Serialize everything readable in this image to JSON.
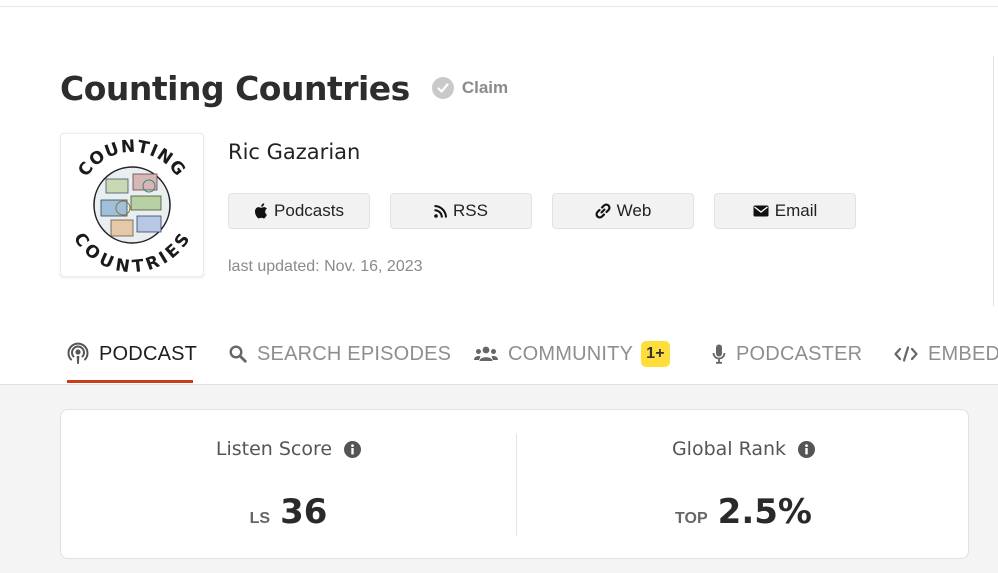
{
  "header": {
    "title": "Counting Countries",
    "claim_label": "Claim",
    "author": "Ric Gazarian",
    "last_updated": "last updated: Nov. 16, 2023"
  },
  "artwork": {
    "top_text": "COUNTING",
    "bottom_text": "COUNTRIES"
  },
  "links": [
    {
      "label": "Podcasts",
      "icon": "apple-icon"
    },
    {
      "label": "RSS",
      "icon": "rss-icon"
    },
    {
      "label": "Web",
      "icon": "link-icon"
    },
    {
      "label": "Email",
      "icon": "envelope-icon"
    }
  ],
  "tabs": [
    {
      "label": "PODCAST",
      "icon": "podcast-icon",
      "active": true
    },
    {
      "label": "SEARCH EPISODES",
      "icon": "search-icon"
    },
    {
      "label": "COMMUNITY",
      "icon": "users-icon",
      "badge": "1+"
    },
    {
      "label": "PODCASTER",
      "icon": "microphone-icon"
    },
    {
      "label": "EMBED",
      "icon": "code-icon"
    }
  ],
  "stats": {
    "listen_score": {
      "label": "Listen Score",
      "prefix": "LS",
      "value": "36"
    },
    "global_rank": {
      "label": "Global Rank",
      "prefix": "TOP",
      "value": "2.5%"
    }
  },
  "colors": {
    "active_tab_underline": "#c93e17",
    "badge": "#ffde3b"
  }
}
